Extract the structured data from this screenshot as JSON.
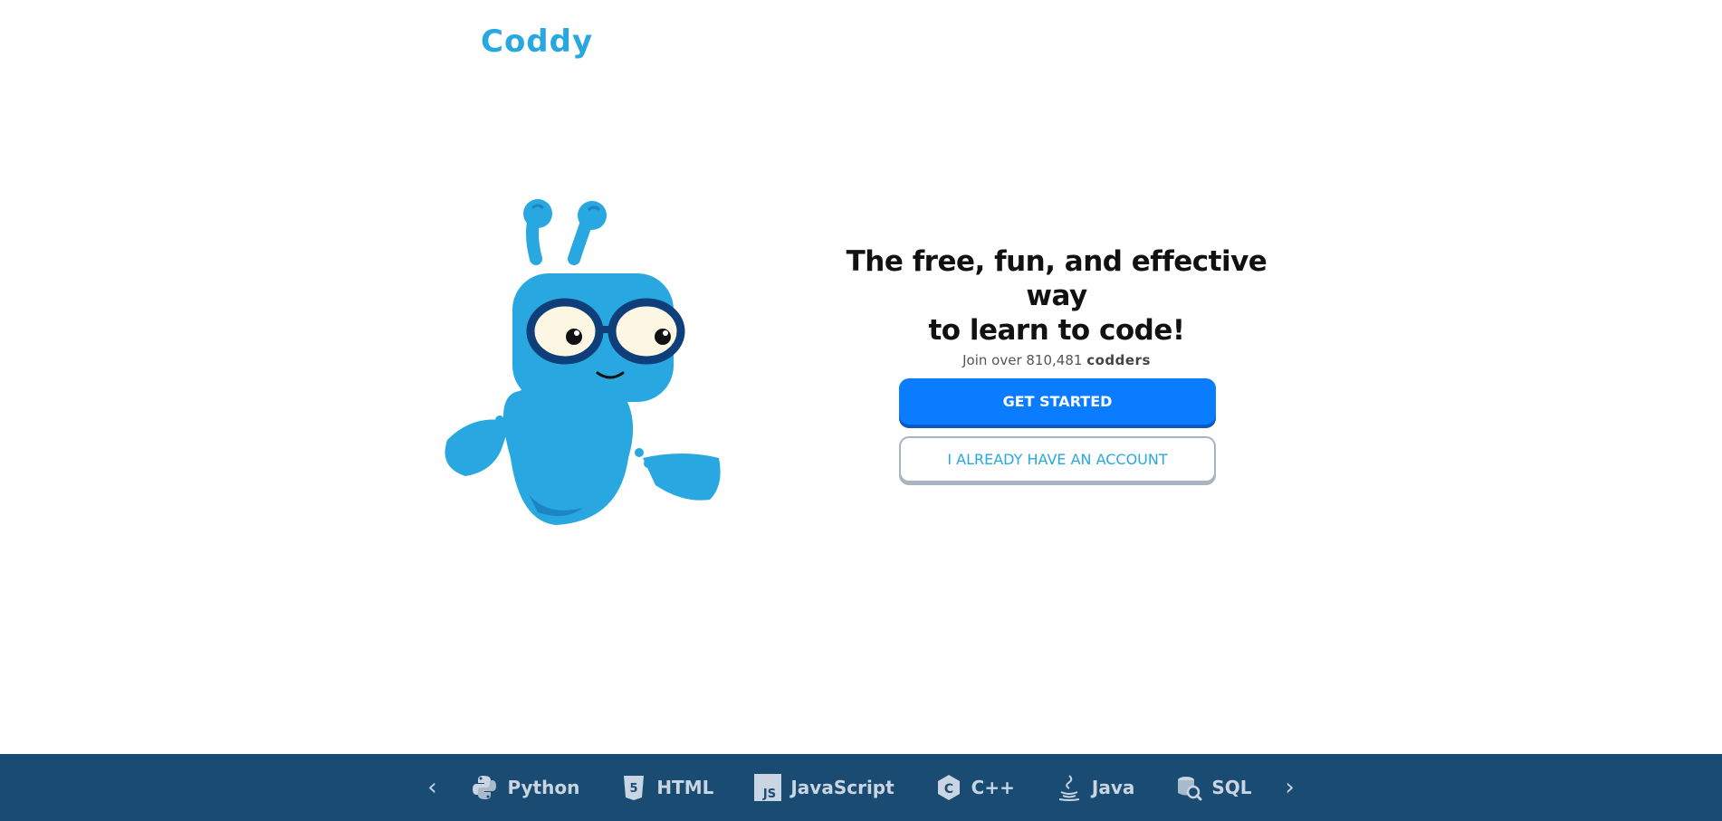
{
  "header": {
    "logo_text": "Coddy"
  },
  "hero": {
    "headline": "The free, fun, and effective way\nto learn to code!",
    "join_prefix": "Join over 810,481",
    "join_brand": "codders",
    "primary_button": "GET STARTED",
    "secondary_button": "I ALREADY HAVE AN ACCOUNT"
  },
  "footer": {
    "prev_label": "‹",
    "next_label": "›",
    "languages": [
      {
        "label": "Python",
        "icon": "python-icon"
      },
      {
        "label": "HTML",
        "icon": "html5-icon"
      },
      {
        "label": "JavaScript",
        "icon": "javascript-icon"
      },
      {
        "label": "C++",
        "icon": "cpp-icon"
      },
      {
        "label": "Java",
        "icon": "java-icon"
      },
      {
        "label": "SQL",
        "icon": "sql-icon"
      }
    ]
  },
  "colors": {
    "brand_blue": "#29a7e1",
    "primary_button": "#0a7cff",
    "footer_bg": "#1a4b72"
  }
}
